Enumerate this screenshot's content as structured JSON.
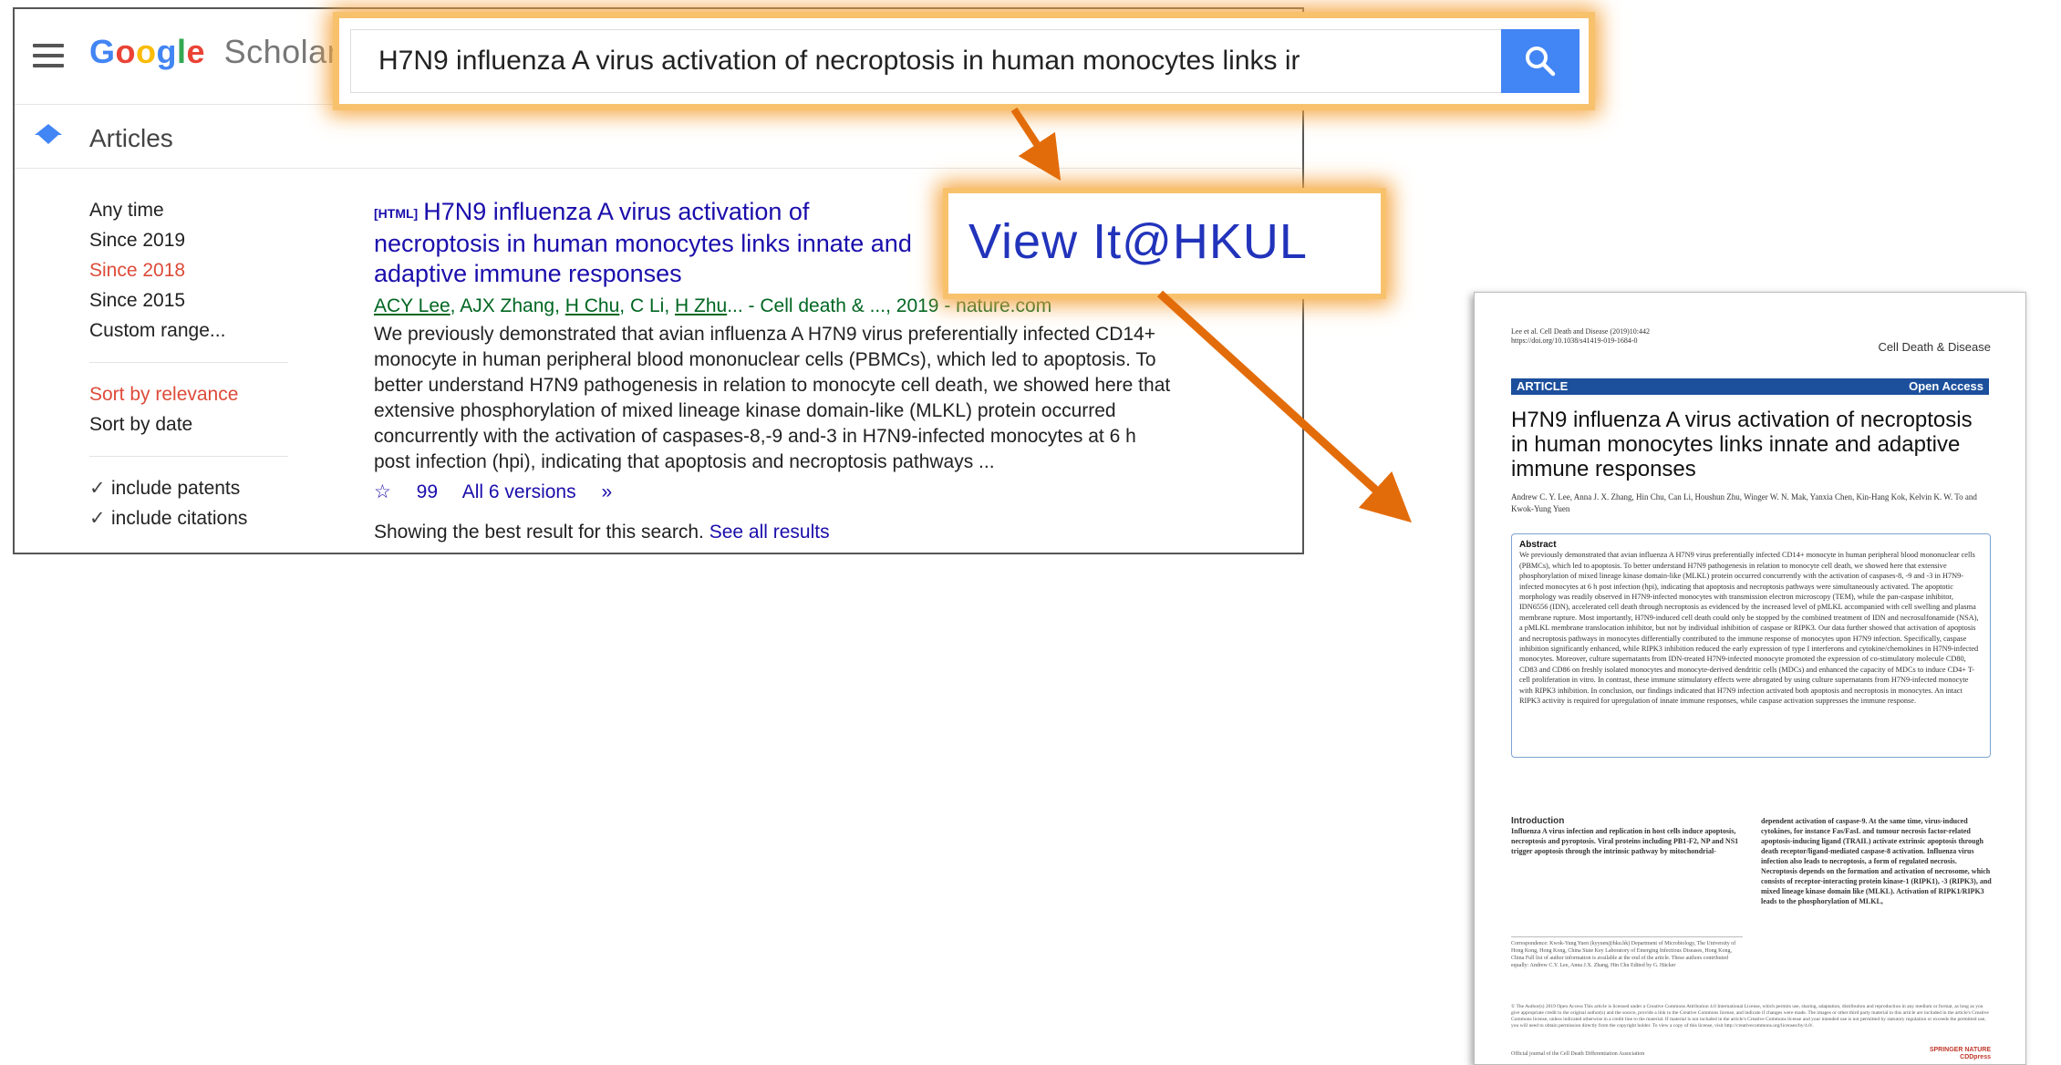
{
  "header": {
    "logo_google": "Google",
    "logo_scholar": "Scholar"
  },
  "search": {
    "query": "H7N9 influenza A virus activation of necroptosis in human monocytes links ir"
  },
  "nav": {
    "articles_label": "Articles"
  },
  "sidebar": {
    "time_filters": [
      "Any time",
      "Since 2019",
      "Since 2018",
      "Since 2015",
      "Custom range..."
    ],
    "sort_relevance": "Sort by relevance",
    "sort_date": "Sort by date",
    "include_patents": "include patents",
    "include_citations": "include citations"
  },
  "result": {
    "tag": "[HTML]",
    "title_line1": "H7N9 influenza A virus activation of",
    "title_line2": "necroptosis in human monocytes links innate and",
    "title_line3": "adaptive immune responses",
    "authors": {
      "a1": "ACY Lee",
      "a2": "AJX Zhang",
      "a3": "H Chu",
      "a4": "C Li",
      "a5": "H Zhu",
      "rest": "... - Cell death & ..., 2019 - nature.com"
    },
    "snippet": "We previously demonstrated that avian influenza A H7N9 virus preferentially infected CD14+ monocyte in human peripheral blood mononuclear cells (PBMCs), which led to apoptosis. To better understand H7N9 pathogenesis in relation to monocyte cell death, we showed here that extensive phosphorylation of mixed lineage kinase domain-like (MLKL) protein occurred concurrently with the activation of caspases-8,-9 and-3 in H7N9-infected monocytes at 6 h post infection (hpi), indicating that apoptosis and necroptosis pathways ...",
    "star": "☆",
    "cite": "99",
    "versions": "All 6 versions",
    "more": "»"
  },
  "showing": {
    "text": "Showing the best result for this search.",
    "link": "See all results"
  },
  "viewit": {
    "label": "View It@HKUL"
  },
  "paper": {
    "ref_line1": "Lee et al. Cell Death and Disease (2019)10:442",
    "ref_line2": "https://doi.org/10.1038/s41419-019-1684-0",
    "journal": "Cell Death & Disease",
    "article_label": "ARTICLE",
    "open_access": "Open Access",
    "title": "H7N9 influenza A virus activation of necroptosis in human monocytes links innate and adaptive immune responses",
    "authors": "Andrew C. Y. Lee, Anna J. X. Zhang, Hin Chu, Can Li, Houshun Zhu, Winger W. N. Mak, Yanxia Chen, Kin-Hang Kok, Kelvin K. W. To and Kwok-Yung Yuen",
    "abstract_heading": "Abstract",
    "abstract": "We previously demonstrated that avian influenza A H7N9 virus preferentially infected CD14+ monocyte in human peripheral blood mononuclear cells (PBMCs), which led to apoptosis. To better understand H7N9 pathogenesis in relation to monocyte cell death, we showed here that extensive phosphorylation of mixed lineage kinase domain-like (MLKL) protein occurred concurrently with the activation of caspases-8, -9 and -3 in H7N9-infected monocytes at 6 h post infection (hpi), indicating that apoptosis and necroptosis pathways were simultaneously activated. The apoptotic morphology was readily observed in H7N9-infected monocytes with transmission electron microscopy (TEM), while the pan-caspase inhibitor, IDN6556 (IDN), accelerated cell death through necroptosis as evidenced by the increased level of pMLKL accompanied with cell swelling and plasma membrane rupture. Most importantly, H7N9-induced cell death could only be stopped by the combined treatment of IDN and necrosulfonamide (NSA), a pMLKL membrane translocation inhibitor, but not by individual inhibition of caspase or RIPK3. Our data further showed that activation of apoptosis and necroptosis pathways in monocytes differentially contributed to the immune response of monocytes upon H7N9 infection. Specifically, caspase inhibition significantly enhanced, while RIPK3 inhibition reduced the early expression of type I interferons and cytokine/chemokines in H7N9-infected monocytes. Moreover, culture supernatants from IDN-treated H7N9-infected monocyte promoted the expression of co-stimulatory molecule CD80, CD83 and CD86 on freshly isolated monocytes and monocyte-derived dendritic cells (MDCs) and enhanced the capacity of MDCs to induce CD4+ T-cell proliferation in vitro. In contrast, these immune stimulatory effects were abrogated by using culture supernatants from H7N9-infected monocyte with RIPK3 inhibition. In conclusion, our findings indicated that H7N9 infection activated both apoptosis and necroptosis in monocytes. An intact RIPK3 activity is required for upregulation of innate immune responses, while caspase activation suppresses the immune response.",
    "intro_heading": "Introduction",
    "intro_left": "Influenza A virus infection and replication in host cells induce apoptosis, necroptosis and pyroptosis. Viral proteins including PB1-F2, NP and NS1 trigger apoptosis through the intrinsic pathway by mitochondrial-",
    "intro_right": "dependent activation of caspase-9. At the same time, virus-induced cytokines, for instance Fas/FasL and tumour necrosis factor-related apoptosis-inducing ligand (TRAIL) activate extrinsic apoptosis through death receptor/ligand-mediated caspase-8 activation. Influenza virus infection also leads to necroptosis, a form of regulated necrosis. Necroptosis depends on the formation and activation of necrosome, which consists of receptor-interacting protein kinase-1 (RIPK1), -3 (RIPK3), and mixed lineage kinase domain like (MLKL). Activation of RIPK1/RIPK3 leads to the phosphorylation of MLKL,",
    "correspondence": "Correspondence: Kwok-Yung Yuen (kyyuen@hku.hk) Department of Microbiology, The University of Hong Kong, Hong Kong, China State Key Laboratory of Emerging Infectious Diseases, Hong Kong, China Full list of author information is available at the end of the article. These authors contributed equally: Andrew C.Y. Lee, Anna J.X. Zhang, Hin Chu Edited by G. Häcker",
    "open_access_text": "© The Author(s) 2019 Open Access This article is licensed under a Creative Commons Attribution 4.0 International License, which permits use, sharing, adaptation, distribution and reproduction in any medium or format, as long as you give appropriate credit to the original author(s) and the source, provide a link to the Creative Commons license, and indicate if changes were made. The images or other third party material in this article are included in the article's Creative Commons license, unless indicated otherwise in a credit line to the material. If material is not included in the article's Creative Commons license and your intended use is not permitted by statutory regulation or exceeds the permitted use, you will need to obtain permission directly from the copyright holder. To view a copy of this license, visit http://creativecommons.org/licenses/by/4.0/.",
    "footer": "Official journal of the Cell Death Differentiation Association",
    "publisher1": "SPRINGER NATURE",
    "publisher2": "CDDpress"
  },
  "colors": {
    "highlight": "#f5a643",
    "arrow": "#e36c0a",
    "link": "#1a0dab",
    "accent_red": "#dd4b39",
    "search_blue": "#4285f4"
  }
}
